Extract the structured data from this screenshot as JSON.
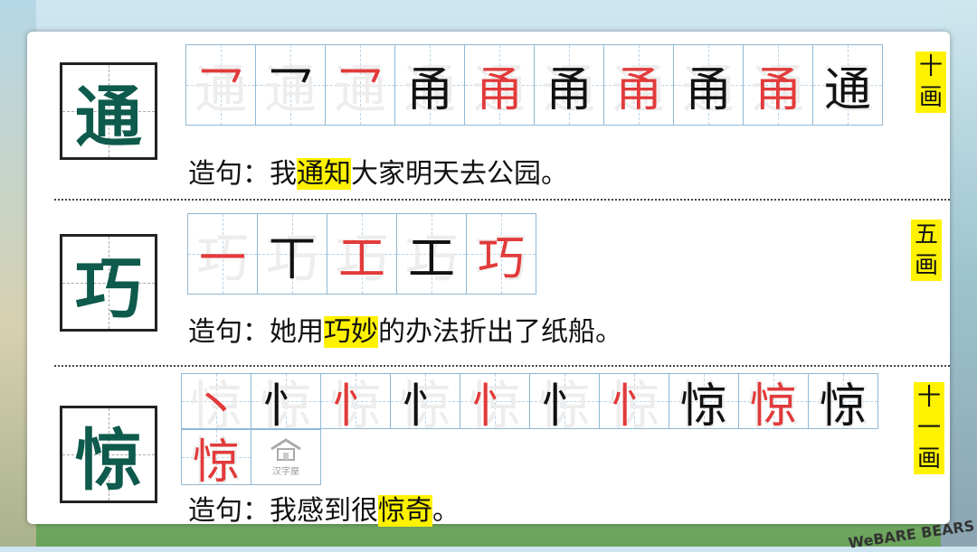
{
  "rows": [
    {
      "char": "通",
      "strokes": [
        "乛",
        "乛",
        "乛",
        "甬",
        "甬",
        "甬",
        "甬",
        "甬",
        "甬",
        "通"
      ],
      "sentence_prefix": "造句：我",
      "sentence_highlight": "通知",
      "sentence_suffix": "大家明天去公园。",
      "count": [
        "十",
        "画"
      ]
    },
    {
      "char": "巧",
      "strokes": [
        "一",
        "丅",
        "工",
        "工",
        "巧"
      ],
      "sentence_prefix": "造句：她用",
      "sentence_highlight": "巧妙",
      "sentence_suffix": "的办法折出了纸船。",
      "count": [
        "五",
        "画"
      ]
    },
    {
      "char": "惊",
      "strokes": [
        "丶",
        "忄",
        "忄",
        "忄",
        "忄",
        "忄",
        "忄",
        "惊",
        "惊",
        "惊",
        "惊"
      ],
      "sentence_prefix": "造句：我感到很",
      "sentence_highlight": "惊奇",
      "sentence_suffix": "。",
      "count": [
        "十",
        "一",
        "画"
      ]
    }
  ],
  "logo_text": "汉字屋",
  "watermark": "WeBARE BEARS"
}
